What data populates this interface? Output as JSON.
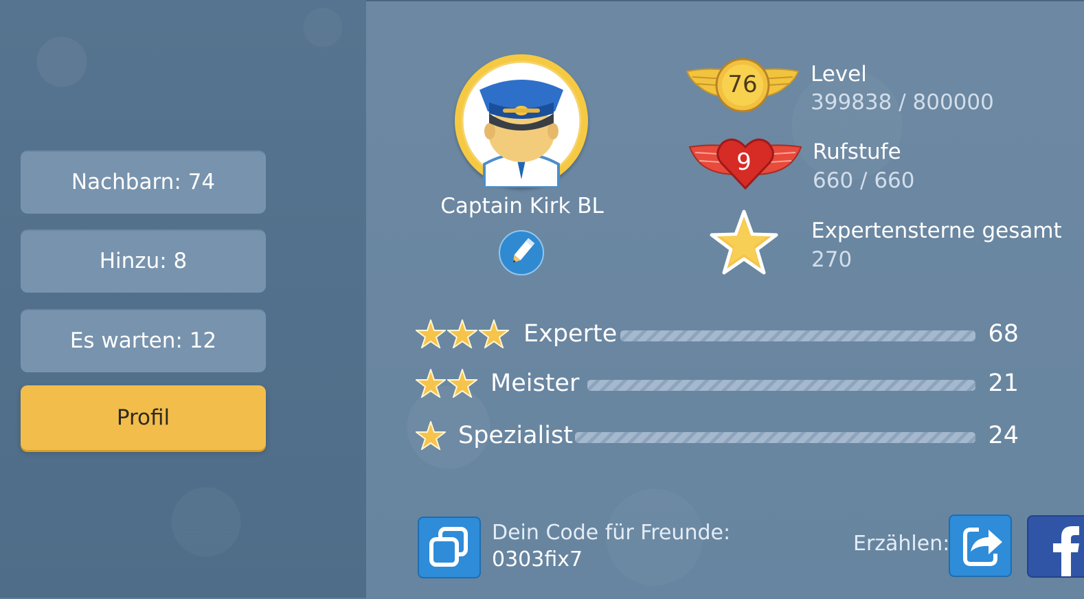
{
  "sidebar": {
    "buttons": [
      {
        "label": "Nachbarn: 74"
      },
      {
        "label": "Hinzu: 8"
      },
      {
        "label": "Es warten: 12"
      },
      {
        "label": "Profil"
      }
    ],
    "active_index": 3
  },
  "profile": {
    "name": "Captain Kirk BL",
    "avatar_icon": "captain-avatar-icon",
    "edit_icon": "pencil-icon"
  },
  "stats": {
    "level": {
      "badge": "76",
      "label": "Level",
      "value": "399838 / 800000",
      "icon": "winged-level-badge-icon"
    },
    "reputation": {
      "badge": "9",
      "label": "Rufstufe",
      "value": "660 / 660",
      "icon": "winged-heart-badge-icon"
    },
    "expert_stars": {
      "label": "Expertensterne gesamt",
      "value": "270",
      "icon": "star-icon"
    }
  },
  "ranks": [
    {
      "stars": 3,
      "label": "Experte",
      "count": "68"
    },
    {
      "stars": 2,
      "label": "Meister",
      "count": "21"
    },
    {
      "stars": 1,
      "label": "Spezialist",
      "count": "24"
    }
  ],
  "friend_code": {
    "label": "Dein Code für Freunde:",
    "value": "0303fix7",
    "copy_icon": "copy-icon"
  },
  "share": {
    "label": "Erzählen:",
    "share_icon": "share-arrow-icon",
    "facebook_icon": "facebook-icon"
  },
  "colors": {
    "left_panel": "#52708b",
    "right_panel": "#6b87a1",
    "button": "#7893ad",
    "active_button": "#f3bd4c",
    "accent_blue": "#2e8cd8"
  }
}
